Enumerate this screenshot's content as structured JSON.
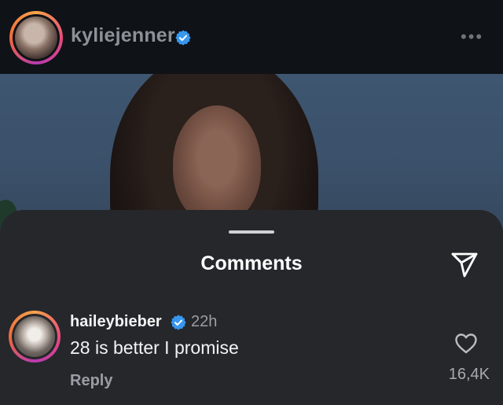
{
  "header": {
    "username": "kyliejenner",
    "verified_icon": "verified-badge-icon",
    "more_icon": "more-horizontal-icon",
    "more_glyph": "•••"
  },
  "comments_sheet": {
    "title": "Comments",
    "share_icon": "send-icon",
    "comment": {
      "username": "haileybieber",
      "verified_icon": "verified-badge-icon",
      "time": "22h",
      "text": "28 is better I promise",
      "reply_label": "Reply",
      "like_icon": "heart-outline-icon",
      "like_count": "16,4K"
    }
  },
  "colors": {
    "sheet_bg": "#25272b",
    "verified_blue": "#3797f0",
    "muted_text": "#9a9ea4"
  }
}
